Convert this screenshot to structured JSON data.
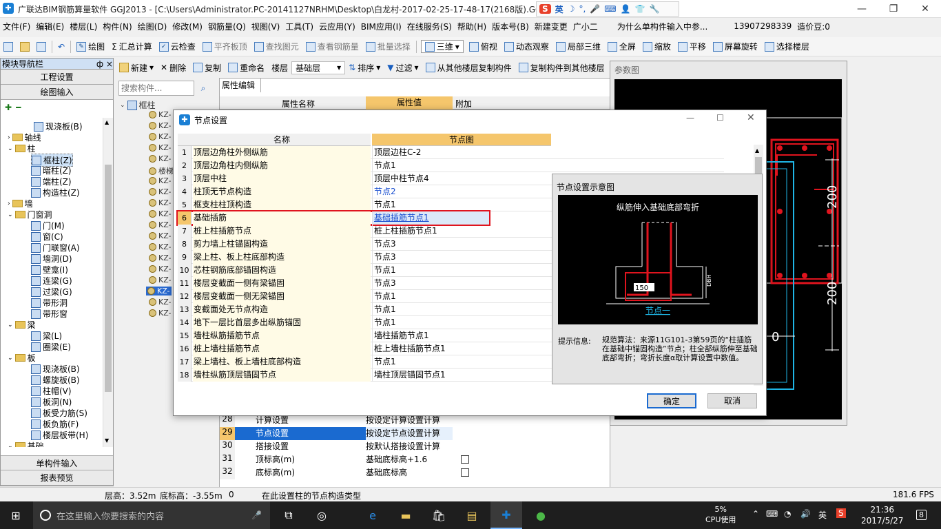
{
  "title": "广联达BIM钢筋算量软件 GGJ2013 - [C:\\Users\\Administrator.PC-20141127NRHM\\Desktop\\白龙村-2017-02-25-17-48-17(2168版).GGJ12]",
  "ime": {
    "label": "英",
    "logo": "S"
  },
  "menu": [
    "文件(F)",
    "编辑(E)",
    "楼层(L)",
    "构件(N)",
    "绘图(D)",
    "修改(M)",
    "钢筋量(Q)",
    "视图(V)",
    "工具(T)",
    "云应用(Y)",
    "BIM应用(I)",
    "在线服务(S)",
    "帮助(H)",
    "版本号(B)",
    "新建变更",
    "广小二",
    "为什么单构件输入中参...",
    "13907298339",
    "造价豆:0"
  ],
  "toolbar1": [
    "绘图",
    "汇总计算",
    "云检查",
    "平齐板顶",
    "查找图元",
    "查看钢筋量",
    "批量选择",
    "三维",
    "俯视",
    "动态观察",
    "局部三维",
    "全屏",
    "缩放",
    "平移",
    "屏幕旋转",
    "选择楼层"
  ],
  "toolbar2": [
    "新建",
    "删除",
    "复制",
    "重命名",
    "楼层",
    "基础层",
    "排序",
    "过滤",
    "从其他楼层复制构件",
    "复制构件到其他楼层"
  ],
  "nav": {
    "title": "模块导航栏",
    "pin": "ф ×",
    "btn_project": "工程设置",
    "btn_draw": "绘图输入",
    "btn_single": "单构件输入",
    "btn_report": "报表预览",
    "tree": [
      "现浇板(B)",
      "轴线",
      "柱",
      "框柱(Z)",
      "暗柱(Z)",
      "端柱(Z)",
      "构造柱(Z)",
      "墙",
      "门窗洞",
      "门(M)",
      "窗(C)",
      "门联窗(A)",
      "墙洞(D)",
      "壁龛(I)",
      "连梁(G)",
      "过梁(G)",
      "带形洞",
      "带形窗",
      "梁",
      "梁(L)",
      "圈梁(E)",
      "板",
      "现浇板(B)",
      "螺旋板(B)",
      "柱帽(V)",
      "板洞(N)",
      "板受力筋(S)",
      "板负筋(F)",
      "楼层板带(H)",
      "基础"
    ]
  },
  "component_search_placeholder": "搜索构件...",
  "component_tree": {
    "root": "框柱",
    "items": [
      "KZ-",
      "KZ-",
      "KZ-",
      "KZ-",
      "KZ-",
      "楼梯",
      "KZ-",
      "KZ-",
      "KZ-",
      "KZ-",
      "KZ-",
      "KZ-",
      "KZ-",
      "KZ-",
      "KZ-",
      "KZ-",
      "KZ-",
      "KZ-",
      "KZ-"
    ]
  },
  "props": {
    "tab": "属性编辑",
    "headers": [
      "属性名称",
      "属性值",
      "附加"
    ],
    "rows": [
      {
        "num": "28",
        "name": "计算设置",
        "value": "按设定计算设置计算"
      },
      {
        "num": "29",
        "name": "节点设置",
        "value": "按设定节点设置计算"
      },
      {
        "num": "30",
        "name": "搭接设置",
        "value": "按默认搭接设置计算"
      },
      {
        "num": "31",
        "name": "顶标高(m)",
        "value": "基础底标高+1.6"
      },
      {
        "num": "32",
        "name": "底标高(m)",
        "value": "基础底标高"
      }
    ]
  },
  "preview": {
    "title": "参数图",
    "dims": [
      "200",
      "200",
      "0"
    ]
  },
  "dialog": {
    "title": "节点设置",
    "col_name": "名称",
    "col_node": "节点图",
    "rows": [
      {
        "num": "1",
        "name": "顶层边角柱外侧纵筋",
        "value": "顶层边柱C-2"
      },
      {
        "num": "2",
        "name": "顶层边角柱内侧纵筋",
        "value": "节点1"
      },
      {
        "num": "3",
        "name": "顶层中柱",
        "value": "顶层中柱节点4"
      },
      {
        "num": "4",
        "name": "柱顶无节点构造",
        "value": "节点2"
      },
      {
        "num": "5",
        "name": "框支柱柱顶构造",
        "value": "节点1"
      },
      {
        "num": "6",
        "name": "基础插筋",
        "value": "基础插筋节点1"
      },
      {
        "num": "7",
        "name": "桩上柱插筋节点",
        "value": "桩上柱插筋节点1"
      },
      {
        "num": "8",
        "name": "剪力墙上柱锚固构造",
        "value": "节点3"
      },
      {
        "num": "9",
        "name": "梁上柱、板上柱底部构造",
        "value": "节点3"
      },
      {
        "num": "10",
        "name": "芯柱钢筋底部锚固构造",
        "value": "节点1"
      },
      {
        "num": "11",
        "name": "楼层变截面一侧有梁锚固",
        "value": "节点3"
      },
      {
        "num": "12",
        "name": "楼层变截面一侧无梁锚固",
        "value": "节点1"
      },
      {
        "num": "13",
        "name": "变截面处无节点构造",
        "value": "节点1"
      },
      {
        "num": "14",
        "name": "地下一层比首层多出纵筋锚固",
        "value": "节点1"
      },
      {
        "num": "15",
        "name": "墙柱纵筋插筋节点",
        "value": "墙柱插筋节点1"
      },
      {
        "num": "16",
        "name": "桩上墙柱插筋节点",
        "value": "桩上墙柱插筋节点1"
      },
      {
        "num": "17",
        "name": "梁上墙柱、板上墙柱底部构造",
        "value": "节点1"
      },
      {
        "num": "18",
        "name": "墙柱纵筋顶层锚固节点",
        "value": "墙柱顶层锚固节点1"
      }
    ],
    "schema_title": "节点设置示意图",
    "schema_caption": "纵筋伸入基础底部弯折",
    "schema_input": "150",
    "schema_dim": "DBH",
    "schema_node": "节点一",
    "hint_label": "提示信息:",
    "hint_text": "规范算法：来源11G101-3第59页的“柱插筋在基础中锚固构造”节点；柱全部纵筋伸至基础底部弯折；弯折长度α取计算设置中数值。",
    "ok": "确定",
    "cancel": "取消"
  },
  "status": {
    "floor_height": "层高：3.52m",
    "base_elev": "底标高：-3.55m",
    "zero": "0",
    "hint": "在此设置柱的节点构造类型",
    "fps": "181.6 FPS"
  },
  "taskbar": {
    "search": "在这里输入你要搜索的内容",
    "cpu_pct": "5%",
    "cpu_label": "CPU使用",
    "lang": "英",
    "time": "21:36",
    "date": "2017/5/27",
    "notif": "8"
  },
  "colors": {
    "selected_blue": "#0a62d0",
    "header_orange": "#f5c66c",
    "highlight_red": "#e0141e",
    "cyan": "#1fb6e6"
  }
}
